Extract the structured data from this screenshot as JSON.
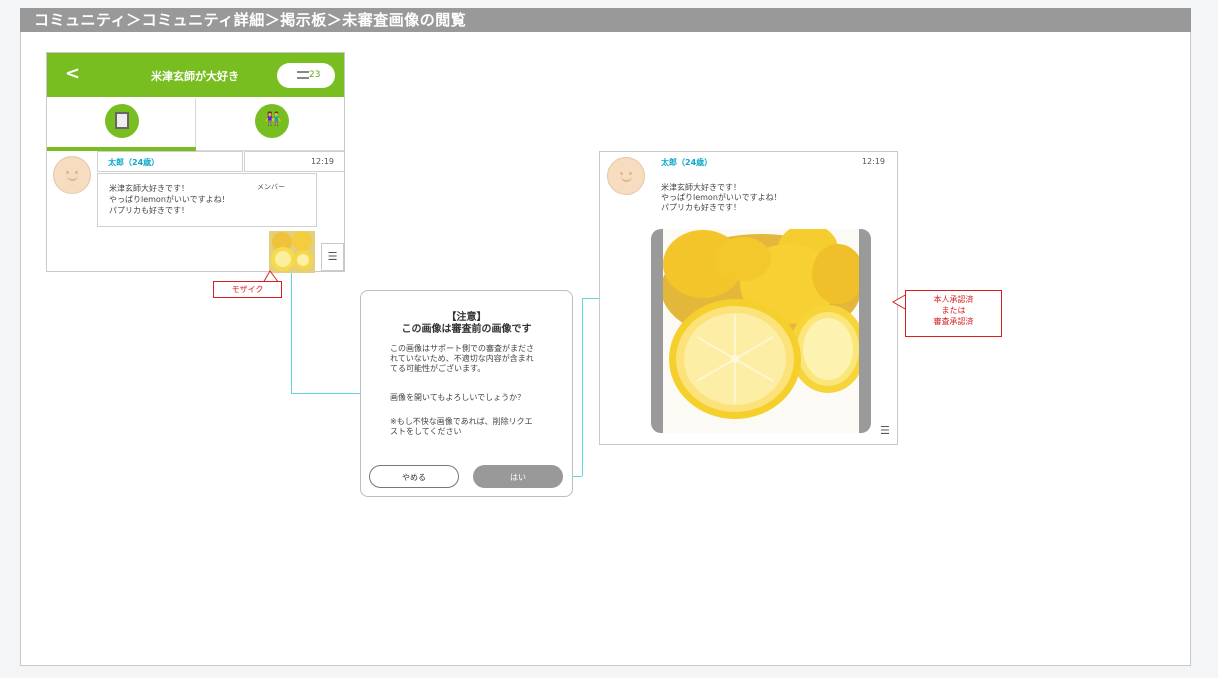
{
  "page": {
    "breadcrumb": "コミュニティ＞コミュニティ詳細＞掲示板＞未審査画像の閲覧"
  },
  "phone": {
    "back": "<",
    "title": "米津玄師が大好き",
    "badge_count": "23",
    "tab_members": "メンバー",
    "post": {
      "name": "太郎（24歳）",
      "time": "12:19",
      "lines": [
        "米津玄師大好きです！",
        "やっぱりlemonがいいですよね！",
        "パプリカも好きです！"
      ]
    },
    "menu_glyph": "☰"
  },
  "annotations": {
    "mosaic": "モザイク",
    "approved_lines": [
      "本人承認済",
      "または",
      "審査承認済"
    ]
  },
  "dialog": {
    "title_line1": "【注意】",
    "title_line2": "この画像は審査前の画像です",
    "body1": [
      "この画像はサポート側での審査がまださ",
      "れていないため、不適切な内容が含まれ",
      "てる可能性がございます。"
    ],
    "body2": "画像を開いてもよろしいでしょうか？",
    "body3": [
      "※もし不快な画像であれば、削除リクエ",
      "ストをしてください"
    ],
    "cancel": "やめる",
    "ok": "はい"
  },
  "colors": {
    "green": "#78be20",
    "header_gray": "#999999",
    "name_blue": "#0da9c7",
    "red": "#d81e1e",
    "connector": "#5ed6de"
  }
}
